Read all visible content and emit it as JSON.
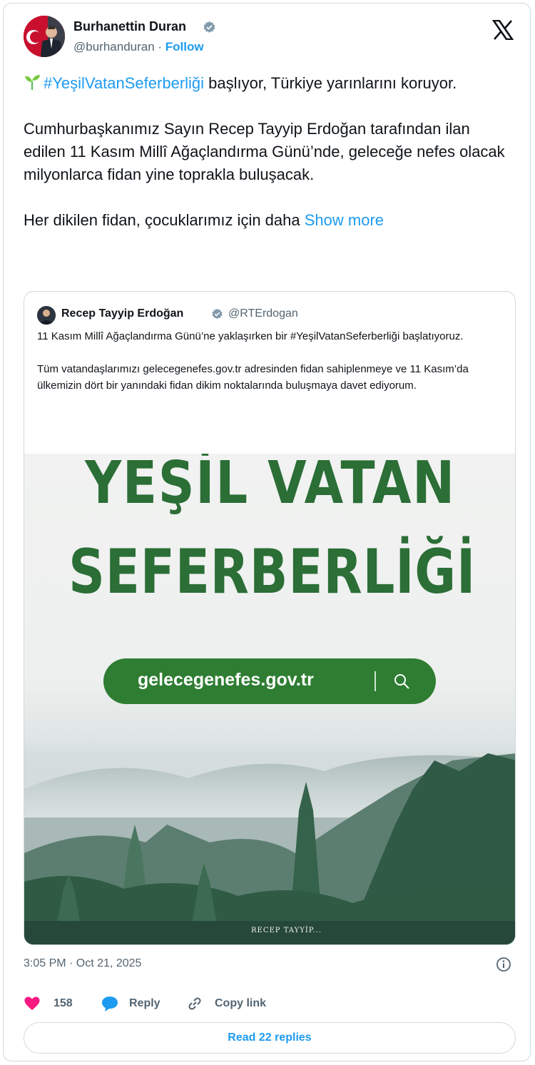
{
  "author": {
    "name": "Burhanettin Duran",
    "handle": "@burhanduran",
    "separator": " · ",
    "follow_label": "Follow"
  },
  "tweet": {
    "hashtag": "#YeşilVatanSeferberliği",
    "line1_rest": " başlıyor, Türkiye yarınlarını koruyor.",
    "paragraph2": "Cumhurbaşkanımız Sayın Recep Tayyip Erdoğan tarafından ilan edilen 11 Kasım Millî Ağaçlandırma Günü’nde, geleceğe nefes olacak milyonlarca fidan yine toprakla buluşacak.",
    "paragraph3": "Her dikilen fidan, çocuklarımız için daha ",
    "show_more": "Show more"
  },
  "quote": {
    "name": "Recep Tayyip Erdoğan",
    "handle": "@RTErdogan",
    "paragraph1": "11 Kasım Millî Ağaçlandırma Günü’ne yaklaşırken bir #YeşilVatanSeferberliği başlatıyoruz.",
    "paragraph2": "Tüm vatandaşlarımızı gelecegenefes.gov.tr adresinden fidan sahiplenmeye ve 11 Kasım’da ülkemizin dört bir yanındaki fidan dikim noktalarında buluşmaya davet ediyorum."
  },
  "promo": {
    "title_line1": "YEŞİL VATAN",
    "title_line2": "SEFERBERLİĞİ",
    "url": "gelecegenefes.gov.tr",
    "signature": "RECEP TAYYİP..."
  },
  "meta": {
    "timestamp": "3:05 PM · Oct 21, 2025"
  },
  "actions": {
    "like_count": "158",
    "reply_label": "Reply",
    "copy_label": "Copy link",
    "read_replies": "Read 22 replies"
  },
  "colors": {
    "link": "#1d9bf0",
    "like": "#f91880",
    "title_green": "#2b6e36",
    "url_bar": "#2e7d32"
  },
  "icons": [
    "verified-badge-icon",
    "x-logo-icon",
    "sprout-emoji-icon",
    "search-icon",
    "info-icon",
    "heart-icon",
    "reply-bubble-icon",
    "link-icon"
  ]
}
